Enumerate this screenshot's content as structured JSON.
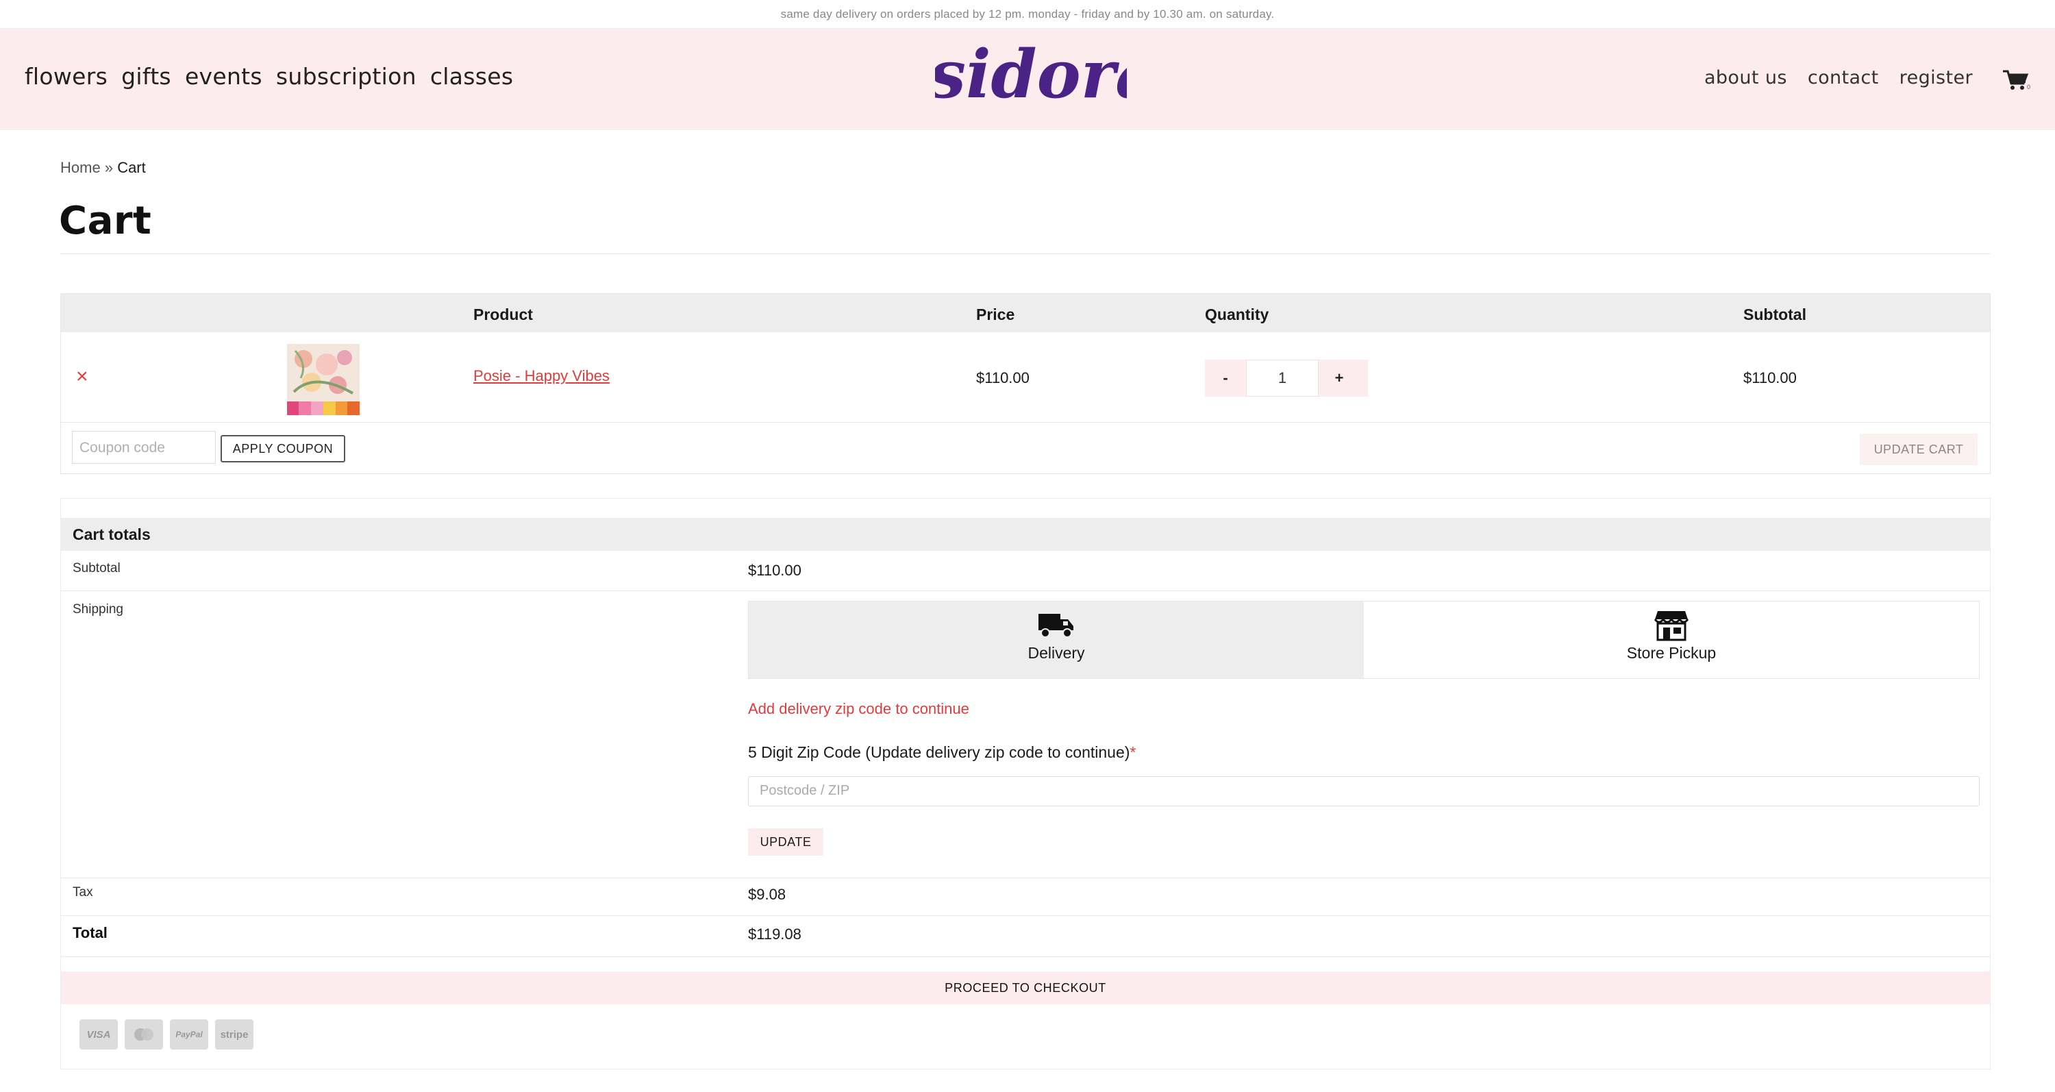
{
  "announcement": "same day delivery on orders placed by 12 pm. monday - friday and by 10.30 am. on saturday.",
  "header": {
    "nav_left": [
      "flowers",
      "gifts",
      "events",
      "subscription",
      "classes"
    ],
    "logo_text": "isidora",
    "nav_right": [
      "about us",
      "contact",
      "register"
    ],
    "cart_count": "0",
    "brand_color": "#4b2386",
    "bg_color": "#fdeced"
  },
  "breadcrumb": {
    "home": "Home",
    "separator": "»",
    "current": "Cart"
  },
  "page_title": "Cart",
  "cart_table": {
    "headers": [
      "Product",
      "Price",
      "Quantity",
      "Subtotal"
    ],
    "items": [
      {
        "remove_icon": "close-icon",
        "name": "Posie - Happy Vibes",
        "price": "$110.00",
        "qty_minus": "-",
        "quantity": "1",
        "qty_plus": "+",
        "subtotal": "$110.00"
      }
    ],
    "coupon_placeholder": "Coupon code",
    "apply_coupon": "APPLY COUPON",
    "update_cart": "UPDATE CART"
  },
  "totals": {
    "title": "Cart totals",
    "subtotal_label": "Subtotal",
    "subtotal_value": "$110.00",
    "shipping_label": "Shipping",
    "shipping_options": [
      {
        "label": "Delivery",
        "icon": "truck-icon",
        "selected": true
      },
      {
        "label": "Store Pickup",
        "icon": "store-icon",
        "selected": false
      }
    ],
    "zip_warning": "Add delivery zip code to continue",
    "zip_label": "5 Digit Zip Code  (Update delivery zip code to continue)",
    "zip_required": "*",
    "zip_placeholder": "Postcode / ZIP",
    "update_button": "UPDATE",
    "tax_label": "Tax",
    "tax_value": "$9.08",
    "total_label": "Total",
    "total_value": "$119.08",
    "checkout_button": "PROCEED TO CHECKOUT",
    "payment_methods": [
      "VISA",
      "Mastercard",
      "PayPal",
      "stripe"
    ]
  }
}
